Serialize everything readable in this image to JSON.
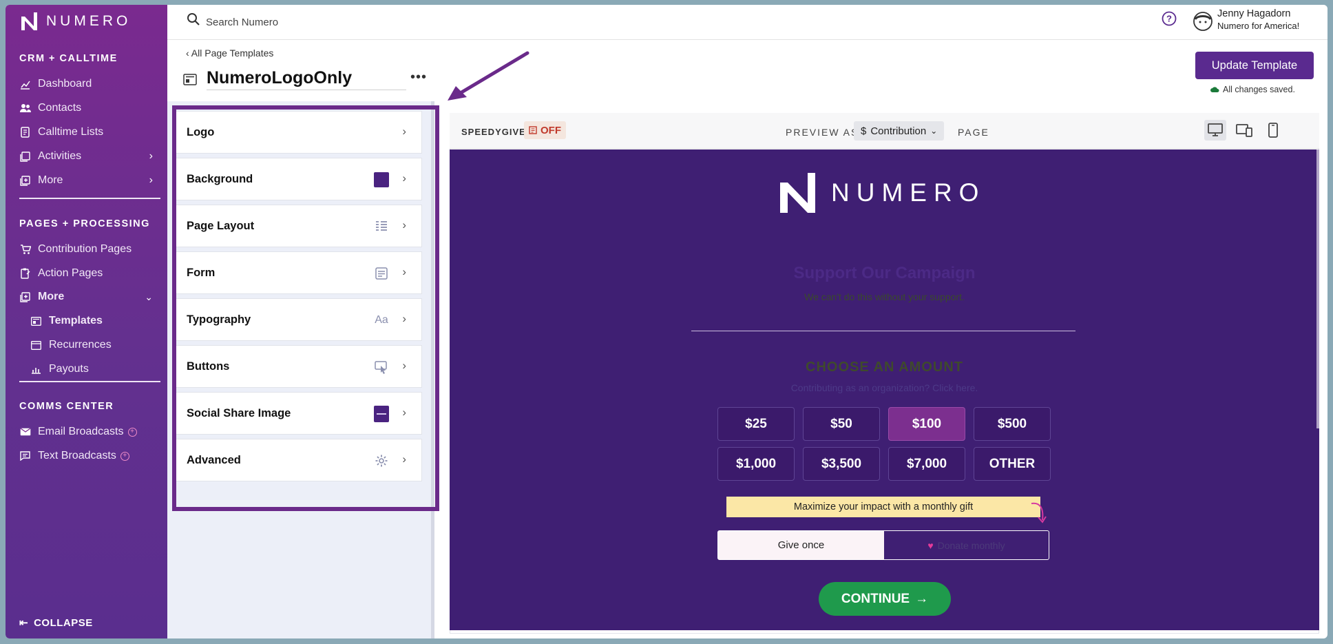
{
  "brand": {
    "name": "NUMERO",
    "accent": "#5a2a8f",
    "sidebar_color": "#6e2d8f"
  },
  "sidebar": {
    "sections": [
      {
        "title": "CRM + CALLTIME"
      },
      {
        "title": "PAGES + PROCESSING"
      },
      {
        "title": "COMMS CENTER"
      }
    ],
    "crm_items": [
      {
        "label": "Dashboard",
        "icon": "chart-icon"
      },
      {
        "label": "Contacts",
        "icon": "people-icon"
      },
      {
        "label": "Calltime Lists",
        "icon": "phone-list-icon"
      },
      {
        "label": "Activities",
        "icon": "activities-icon"
      },
      {
        "label": "More",
        "icon": "more-icon"
      }
    ],
    "pages_items": [
      {
        "label": "Contribution Pages",
        "icon": "cart-icon"
      },
      {
        "label": "Action Pages",
        "icon": "clipboard-icon"
      },
      {
        "label": "More",
        "icon": "more-icon"
      }
    ],
    "pages_sub_items": [
      {
        "label": "Templates",
        "icon": "template-icon"
      },
      {
        "label": "Recurrences",
        "icon": "recurrence-icon"
      },
      {
        "label": "Payouts",
        "icon": "payout-icon"
      }
    ],
    "comms_items": [
      {
        "label": "Email Broadcasts",
        "icon": "email-icon"
      },
      {
        "label": "Text Broadcasts",
        "icon": "text-icon"
      }
    ],
    "collapse_label": "COLLAPSE"
  },
  "topbar": {
    "search_placeholder": "Search Numero",
    "user_name": "Jenny Hagadorn",
    "user_org": "Numero for America!"
  },
  "header": {
    "breadcrumb": "‹ All Page Templates",
    "template_name": "NumeroLogoOnly",
    "update_button": "Update Template",
    "saved_status": "All changes saved."
  },
  "settings": [
    {
      "label": "Logo",
      "icon": ""
    },
    {
      "label": "Background",
      "icon": "color-swatch-icon"
    },
    {
      "label": "Page Layout",
      "icon": "layout-icon"
    },
    {
      "label": "Form",
      "icon": "form-icon"
    },
    {
      "label": "Typography",
      "icon": "typography-icon",
      "glyph": "Aa"
    },
    {
      "label": "Buttons",
      "icon": "button-cursor-icon"
    },
    {
      "label": "Social Share Image",
      "icon": "image-thumb-icon"
    },
    {
      "label": "Advanced",
      "icon": "gear-icon"
    }
  ],
  "preview": {
    "speedygive_label": "SPEEDYGIVE",
    "speedygive_state": "OFF",
    "preview_as_label": "PREVIEW AS",
    "preview_as_value": "Contribution",
    "preview_as_prefix": "$",
    "page_label": "PAGE",
    "logo_text": "NUMERO",
    "title": "Support Our Campaign",
    "subtitle": "We can't do this without your support.",
    "choose_amount": "CHOOSE AN AMOUNT",
    "org_link": "Contributing as an organization? Click here.",
    "amounts": [
      "$25",
      "$50",
      "$100",
      "$500",
      "$1,000",
      "$3,500",
      "$7,000",
      "OTHER"
    ],
    "selected_amount": "$100",
    "monthly_banner": "Maximize your impact with a monthly gift",
    "give_once": "Give once",
    "donate_monthly": "Donate monthly",
    "continue": "CONTINUE",
    "background_color": "#3f1f73",
    "continue_color": "#1f9a4c"
  }
}
